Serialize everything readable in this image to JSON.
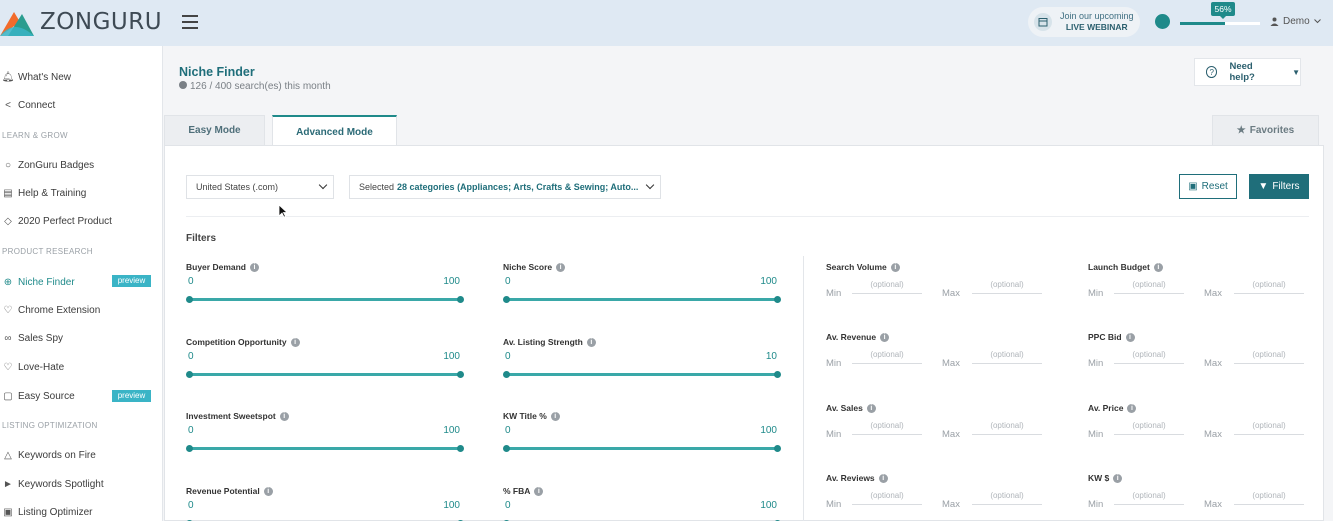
{
  "brand": {
    "name": "ZONGURU",
    "colors": {
      "primary": "#1f6e7a",
      "accent": "#1f8a8a",
      "preview_badge": "#3ab4c6"
    }
  },
  "topbar": {
    "webinar_line1": "Join our upcoming",
    "webinar_line2": "LIVE WEBINAR",
    "progress_label": "56%",
    "progress_value": 56,
    "user_name": "Demo"
  },
  "sidebar": {
    "items": [
      {
        "label": "What's New",
        "icon": "bell-icon"
      },
      {
        "label": "Connect",
        "icon": "share-icon"
      },
      {
        "label": "ZonGuru Badges",
        "icon": "badge-icon"
      },
      {
        "label": "Help & Training",
        "icon": "book-icon"
      },
      {
        "label": "2020 Perfect Product",
        "icon": "diamond-icon"
      },
      {
        "label": "Niche Finder",
        "icon": "crosshair-icon",
        "active": true,
        "badge": "preview"
      },
      {
        "label": "Chrome Extension",
        "icon": "puzzle-icon"
      },
      {
        "label": "Sales Spy",
        "icon": "glasses-icon"
      },
      {
        "label": "Love-Hate",
        "icon": "heart-icon"
      },
      {
        "label": "Easy Source",
        "icon": "box-icon",
        "badge": "preview"
      },
      {
        "label": "Keywords on Fire",
        "icon": "flame-icon"
      },
      {
        "label": "Keywords Spotlight",
        "icon": "spotlight-icon"
      },
      {
        "label": "Listing Optimizer",
        "icon": "image-icon"
      }
    ],
    "sections": [
      "LEARN & GROW",
      "PRODUCT RESEARCH",
      "LISTING OPTIMIZATION"
    ]
  },
  "page": {
    "title": "Niche Finder",
    "searches": "126 / 400 search(es) this month",
    "help_label": "Need help?",
    "tabs": {
      "easy": "Easy Mode",
      "advanced": "Advanced Mode",
      "favorites": "Favorites"
    },
    "marketplace": "United States (.com)",
    "categories_prefix": "Selected",
    "categories_value": "28 categories (Appliances; Arts, Crafts & Sewing; Auto...",
    "reset_label": "Reset",
    "filters_label": "Filters",
    "filters_title": "Filters"
  },
  "sliders": [
    {
      "label": "Buyer Demand",
      "min": "0",
      "max": "100"
    },
    {
      "label": "Niche Score",
      "min": "0",
      "max": "100"
    },
    {
      "label": "Competition Opportunity",
      "min": "0",
      "max": "100"
    },
    {
      "label": "Av. Listing Strength",
      "min": "0",
      "max": "10"
    },
    {
      "label": "Investment Sweetspot",
      "min": "0",
      "max": "100"
    },
    {
      "label": "KW Title %",
      "min": "0",
      "max": "100"
    },
    {
      "label": "Revenue Potential",
      "min": "0",
      "max": "100"
    },
    {
      "label": "% FBA",
      "min": "0",
      "max": "100"
    }
  ],
  "ranges": {
    "min_label": "Min",
    "max_label": "Max",
    "placeholder": "(optional)",
    "items": [
      "Search Volume",
      "Launch Budget",
      "Av. Revenue",
      "PPC Bid",
      "Av. Sales",
      "Av. Price",
      "Av. Reviews",
      "KW $"
    ]
  }
}
